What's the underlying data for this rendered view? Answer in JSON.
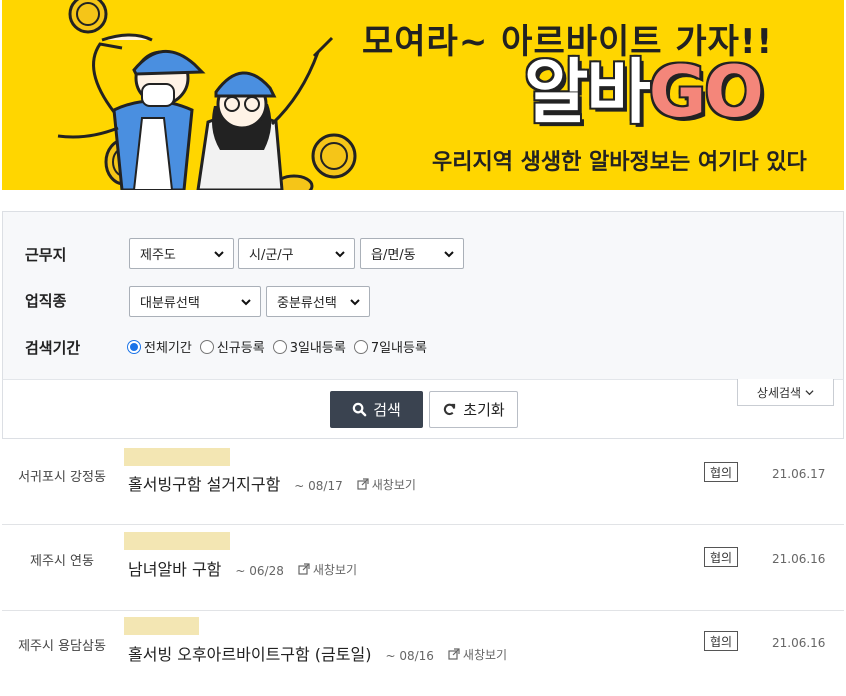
{
  "banner": {
    "tagline": "모여라~ 아르바이트 가자!!",
    "brand_korean": "알바",
    "brand_go": "GO",
    "subline": "우리지역 생생한 알바정보는 여기다 있다"
  },
  "filters": {
    "location_label": "근무지",
    "location_selects": [
      "제주도",
      "시/군/구",
      "읍/면/동"
    ],
    "industry_label": "업직종",
    "industry_selects": [
      "대분류선택",
      "중분류선택"
    ],
    "period_label": "검색기간",
    "period_options": [
      {
        "label": "전체기간",
        "selected": true
      },
      {
        "label": "신규등록",
        "selected": false
      },
      {
        "label": "3일내등록",
        "selected": false
      },
      {
        "label": "7일내등록",
        "selected": false
      }
    ],
    "search_label": "검색",
    "reset_label": "초기화",
    "detail_label": "상세검색"
  },
  "listings": [
    {
      "location": "서귀포시 강정동",
      "title": "홀서빙구함 설거지구함",
      "deadline": "~ 08/17",
      "new_window": "새창보기",
      "pay": "협의",
      "date": "21.06.17"
    },
    {
      "location": "제주시 연동",
      "title": "남녀알바 구함",
      "deadline": "~ 06/28",
      "new_window": "새창보기",
      "pay": "협의",
      "date": "21.06.16"
    },
    {
      "location": "제주시 용담삼동",
      "title": "홀서빙 오후아르바이트구함 (금토일)",
      "deadline": "~ 08/16",
      "new_window": "새창보기",
      "pay": "협의",
      "date": "21.06.16"
    }
  ],
  "colors": {
    "banner_bg": "#ffd600",
    "search_button": "#3a4350",
    "brand_go": "#f4867a",
    "highlight": "#f3e6b3"
  }
}
